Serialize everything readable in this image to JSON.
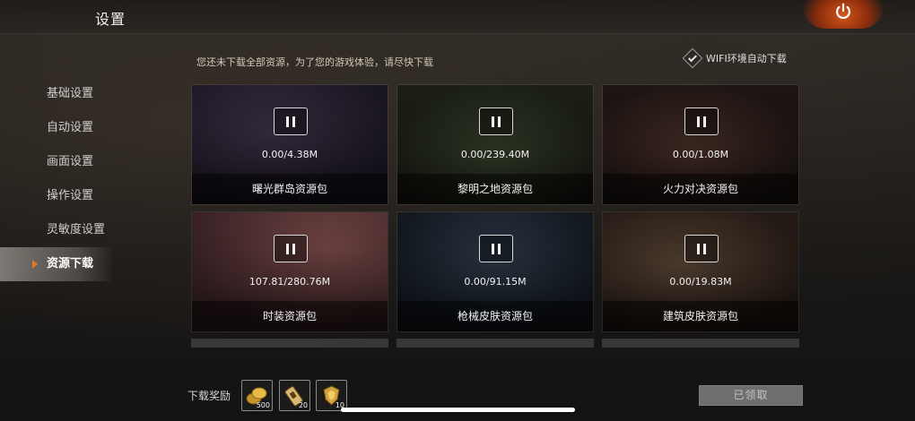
{
  "header": {
    "title": "设置"
  },
  "sidebar": {
    "items": [
      {
        "label": "基础设置"
      },
      {
        "label": "自动设置"
      },
      {
        "label": "画面设置"
      },
      {
        "label": "操作设置"
      },
      {
        "label": "灵敏度设置"
      },
      {
        "label": "资源下载",
        "active": true
      }
    ]
  },
  "main": {
    "notice": "您还未下载全部资源，为了您的游戏体验，请尽快下载",
    "wifi_option": {
      "label": "WIFI环境自动下载",
      "checked": true
    },
    "packages": [
      {
        "name": "曙光群岛资源包",
        "progress": "0.00/4.38M",
        "tint": "#2a2233"
      },
      {
        "name": "黎明之地资源包",
        "progress": "0.00/239.40M",
        "tint": "#262a20"
      },
      {
        "name": "火力对决资源包",
        "progress": "0.00/1.08M",
        "tint": "#2e2220"
      },
      {
        "name": "时装资源包",
        "progress": "107.81/280.76M",
        "tint": "#4a2e30"
      },
      {
        "name": "枪械皮肤资源包",
        "progress": "0.00/91.15M",
        "tint": "#1e2630"
      },
      {
        "name": "建筑皮肤资源包",
        "progress": "0.00/19.83M",
        "tint": "#362a22"
      }
    ]
  },
  "rewards": {
    "label": "下载奖励",
    "items": [
      {
        "icon": "gold-coins-icon",
        "qty": "500"
      },
      {
        "icon": "ticket-icon",
        "qty": "20"
      },
      {
        "icon": "badge-icon",
        "qty": "10"
      }
    ],
    "claim_button": "已领取"
  },
  "colors": {
    "accent": "#e07a2a",
    "power_glow": "#d4551a"
  }
}
